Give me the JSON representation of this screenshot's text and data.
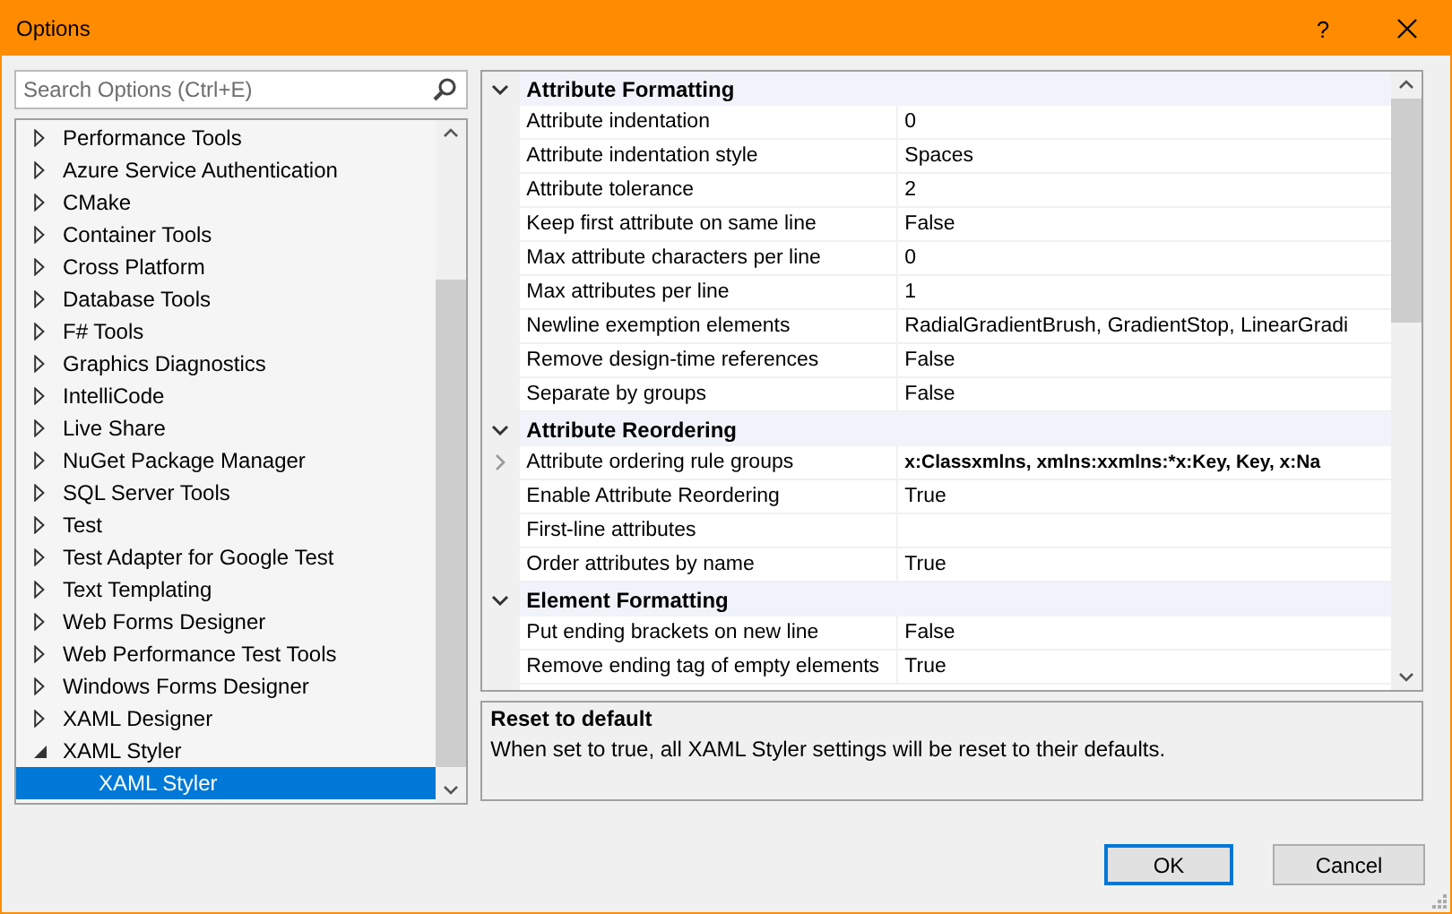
{
  "window": {
    "title": "Options",
    "help": "?"
  },
  "search": {
    "placeholder": "Search Options (Ctrl+E)"
  },
  "tree": [
    {
      "label": "Performance Tools",
      "expanded": false,
      "selected": false
    },
    {
      "label": "Azure Service Authentication",
      "expanded": false,
      "selected": false
    },
    {
      "label": "CMake",
      "expanded": false,
      "selected": false
    },
    {
      "label": "Container Tools",
      "expanded": false,
      "selected": false
    },
    {
      "label": "Cross Platform",
      "expanded": false,
      "selected": false
    },
    {
      "label": "Database Tools",
      "expanded": false,
      "selected": false
    },
    {
      "label": "F# Tools",
      "expanded": false,
      "selected": false
    },
    {
      "label": "Graphics Diagnostics",
      "expanded": false,
      "selected": false
    },
    {
      "label": "IntelliCode",
      "expanded": false,
      "selected": false
    },
    {
      "label": "Live Share",
      "expanded": false,
      "selected": false
    },
    {
      "label": "NuGet Package Manager",
      "expanded": false,
      "selected": false
    },
    {
      "label": "SQL Server Tools",
      "expanded": false,
      "selected": false
    },
    {
      "label": "Test",
      "expanded": false,
      "selected": false
    },
    {
      "label": "Test Adapter for Google Test",
      "expanded": false,
      "selected": false
    },
    {
      "label": "Text Templating",
      "expanded": false,
      "selected": false
    },
    {
      "label": "Web Forms Designer",
      "expanded": false,
      "selected": false
    },
    {
      "label": "Web Performance Test Tools",
      "expanded": false,
      "selected": false
    },
    {
      "label": "Windows Forms Designer",
      "expanded": false,
      "selected": false
    },
    {
      "label": "XAML Designer",
      "expanded": false,
      "selected": false
    },
    {
      "label": "XAML Styler",
      "expanded": true,
      "selected": false,
      "children": [
        {
          "label": "XAML Styler",
          "selected": true
        }
      ]
    }
  ],
  "property_grid": [
    {
      "kind": "category",
      "label": "Attribute Formatting",
      "expanded": true
    },
    {
      "kind": "property",
      "name": "Attribute indentation",
      "value": "0",
      "non_default": false
    },
    {
      "kind": "property",
      "name": "Attribute indentation style",
      "value": "Spaces",
      "non_default": false
    },
    {
      "kind": "property",
      "name": "Attribute tolerance",
      "value": "2",
      "non_default": false
    },
    {
      "kind": "property",
      "name": "Keep first attribute on same line",
      "value": "False",
      "non_default": false
    },
    {
      "kind": "property",
      "name": "Max attribute characters per line",
      "value": "0",
      "non_default": false
    },
    {
      "kind": "property",
      "name": "Max attributes per line",
      "value": "1",
      "non_default": false
    },
    {
      "kind": "property",
      "name": "Newline exemption elements",
      "value": "RadialGradientBrush, GradientStop, LinearGradi",
      "non_default": false
    },
    {
      "kind": "property",
      "name": "Remove design-time references",
      "value": "False",
      "non_default": false
    },
    {
      "kind": "property",
      "name": "Separate by groups",
      "value": "False",
      "non_default": false
    },
    {
      "kind": "category",
      "label": "Attribute Reordering",
      "expanded": true
    },
    {
      "kind": "property",
      "name": "Attribute ordering rule groups",
      "value": "x:Classxmlns, xmlns:xxmlns:*x:Key, Key, x:Na",
      "non_default": true,
      "expanded": false
    },
    {
      "kind": "property",
      "name": "Enable Attribute Reordering",
      "value": "True",
      "non_default": false
    },
    {
      "kind": "property",
      "name": "First-line attributes"
    },
    {
      "kind": "property",
      "name": "Order attributes by name",
      "value": "True",
      "non_default": false
    },
    {
      "kind": "category",
      "label": "Element Formatting",
      "expanded": true
    },
    {
      "kind": "property",
      "name": "Put ending brackets on new line",
      "value": "False",
      "non_default": false
    },
    {
      "kind": "property",
      "name": "Remove ending tag of empty elements",
      "value": "True",
      "non_default": false
    }
  ],
  "description": {
    "title": "Reset to default",
    "text": "When set to true, all XAML Styler settings will be reset to their defaults."
  },
  "buttons": [
    {
      "label": "OK",
      "default": true
    },
    {
      "label": "Cancel",
      "default": false
    }
  ]
}
